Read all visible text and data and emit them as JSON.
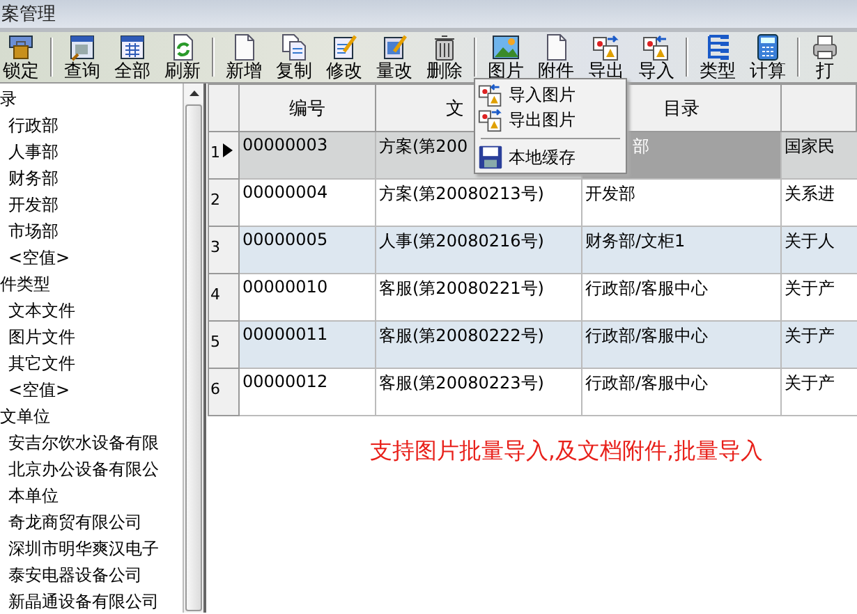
{
  "window": {
    "title": "案管理"
  },
  "toolbar": [
    {
      "kind": "button",
      "label": "锁定"
    },
    {
      "kind": "separator"
    },
    {
      "kind": "button",
      "label": "查询"
    },
    {
      "kind": "button",
      "label": "全部"
    },
    {
      "kind": "button",
      "label": "刷新"
    },
    {
      "kind": "separator"
    },
    {
      "kind": "button",
      "label": "新增"
    },
    {
      "kind": "button",
      "label": "复制"
    },
    {
      "kind": "button",
      "label": "修改"
    },
    {
      "kind": "button",
      "label": "量改"
    },
    {
      "kind": "button",
      "label": "删除"
    },
    {
      "kind": "separator"
    },
    {
      "kind": "button",
      "label": "图片"
    },
    {
      "kind": "button",
      "label": "附件"
    },
    {
      "kind": "button",
      "label": "导出"
    },
    {
      "kind": "button",
      "label": "导入"
    },
    {
      "kind": "separator"
    },
    {
      "kind": "button",
      "label": "类型"
    },
    {
      "kind": "button",
      "label": "计算"
    },
    {
      "kind": "separator"
    },
    {
      "kind": "button",
      "label": "打"
    }
  ],
  "sidebar": {
    "items": [
      {
        "label": "录",
        "children": [
          {
            "label": "行政部"
          },
          {
            "label": "人事部"
          },
          {
            "label": "财务部"
          },
          {
            "label": "开发部"
          },
          {
            "label": "市场部"
          },
          {
            "label": "<空值>"
          }
        ]
      },
      {
        "label": "件类型",
        "children": [
          {
            "label": "文本文件"
          },
          {
            "label": "图片文件"
          },
          {
            "label": "其它文件"
          },
          {
            "label": "<空值>"
          }
        ]
      },
      {
        "label": "文单位",
        "children": [
          {
            "label": "安吉尔饮水设备有限"
          },
          {
            "label": "北京办公设备有限公"
          },
          {
            "label": "本单位"
          },
          {
            "label": "奇龙商贸有限公司"
          },
          {
            "label": "深圳市明华爽汉电子"
          },
          {
            "label": "泰安电器设备公司"
          },
          {
            "label": "新晶通设备有限公司"
          }
        ]
      }
    ]
  },
  "table": {
    "columns": [
      "编号",
      "文",
      "目录"
    ],
    "rows": [
      {
        "number": "1",
        "selected": true,
        "cells": [
          "00000003",
          "方案(第200",
          "部",
          "国家民"
        ]
      },
      {
        "number": "2",
        "selected": false,
        "cells": [
          "00000004",
          "方案(第20080213号)",
          "开发部",
          "关系进"
        ]
      },
      {
        "number": "3",
        "selected": false,
        "cells": [
          "00000005",
          "人事(第20080216号)",
          "财务部/文柜1",
          "关于人"
        ]
      },
      {
        "number": "4",
        "selected": false,
        "cells": [
          "00000010",
          "客服(第20080221号)",
          "行政部/客服中心",
          "关于产"
        ]
      },
      {
        "number": "5",
        "selected": false,
        "cells": [
          "00000011",
          "客服(第20080222号)",
          "行政部/客服中心",
          "关于产"
        ]
      },
      {
        "number": "6",
        "selected": false,
        "cells": [
          "00000012",
          "客服(第20080223号)",
          "行政部/客服中心",
          "关于产"
        ]
      }
    ]
  },
  "context_menu": [
    {
      "kind": "item",
      "label": "导入图片"
    },
    {
      "kind": "item",
      "label": "导出图片"
    },
    {
      "kind": "separator"
    },
    {
      "kind": "item",
      "label": "本地缓存"
    }
  ],
  "caption": "支持图片批量导入,及文档附件,批量导入"
}
